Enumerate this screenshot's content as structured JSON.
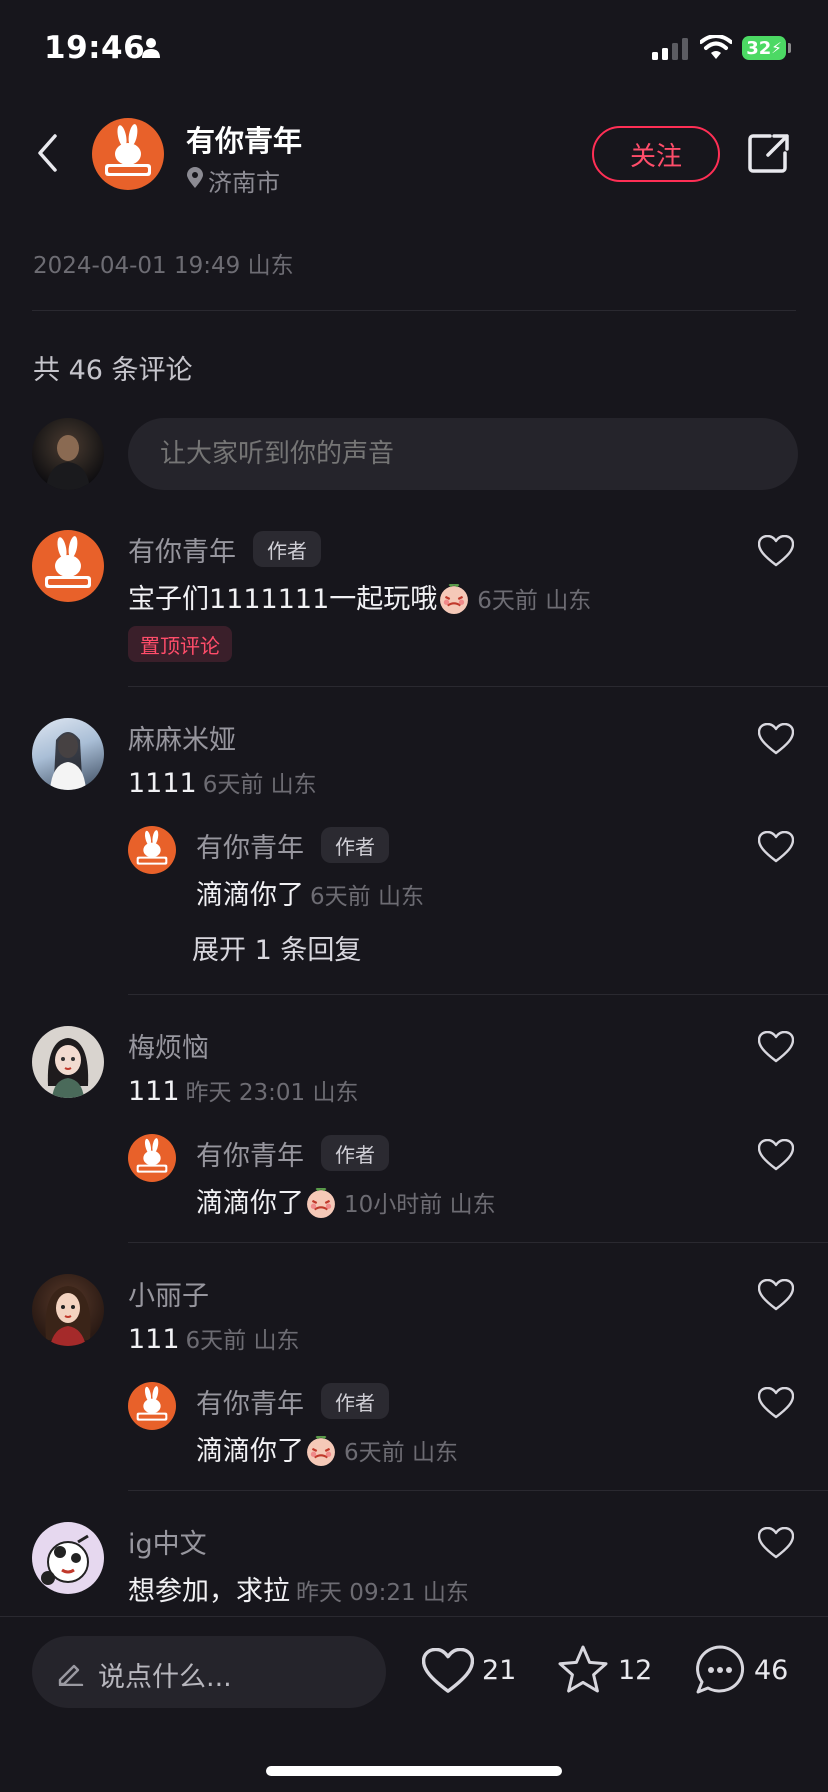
{
  "status": {
    "time": "19:46",
    "battery": "32"
  },
  "header": {
    "name": "有你青年",
    "location": "济南市",
    "follow_label": "关注"
  },
  "post": {
    "datetime_location": "2024-04-01 19:49 山东"
  },
  "comments_header": {
    "count_label": "共 46 条评论"
  },
  "composer": {
    "placeholder": "让大家听到你的声音"
  },
  "comments": [
    {
      "name": "有你青年",
      "tag": "作者",
      "text": "宝子们1111111一起玩哦",
      "meta": "6天前 山东",
      "pinned_label": "置顶评论"
    },
    {
      "name": "麻麻米娅",
      "text": "1111",
      "meta": "6天前 山东",
      "reply": {
        "name": "有你青年",
        "tag": "作者",
        "text": "滴滴你了",
        "meta": "6天前 山东"
      },
      "expand_label": "展开 1 条回复"
    },
    {
      "name": "梅烦恼",
      "text": "111",
      "meta": "昨天 23:01 山东",
      "reply": {
        "name": "有你青年",
        "tag": "作者",
        "text": "滴滴你了",
        "meta": "10小时前 山东"
      }
    },
    {
      "name": "小丽子",
      "text": "111",
      "meta": "6天前 山东",
      "reply": {
        "name": "有你青年",
        "tag": "作者",
        "text": "滴滴你了",
        "meta": "6天前 山东"
      }
    },
    {
      "name": "ig中文",
      "text": "想参加，求拉",
      "meta": "昨天 09:21 山东"
    }
  ],
  "bottom": {
    "placeholder": "说点什么...",
    "likes": "21",
    "favorites": "12",
    "comments": "46"
  },
  "colors": {
    "background": "#17161c",
    "accent": "#ff2f55",
    "avatar_orange": "#e8612a"
  },
  "logo_text": "有你青年"
}
